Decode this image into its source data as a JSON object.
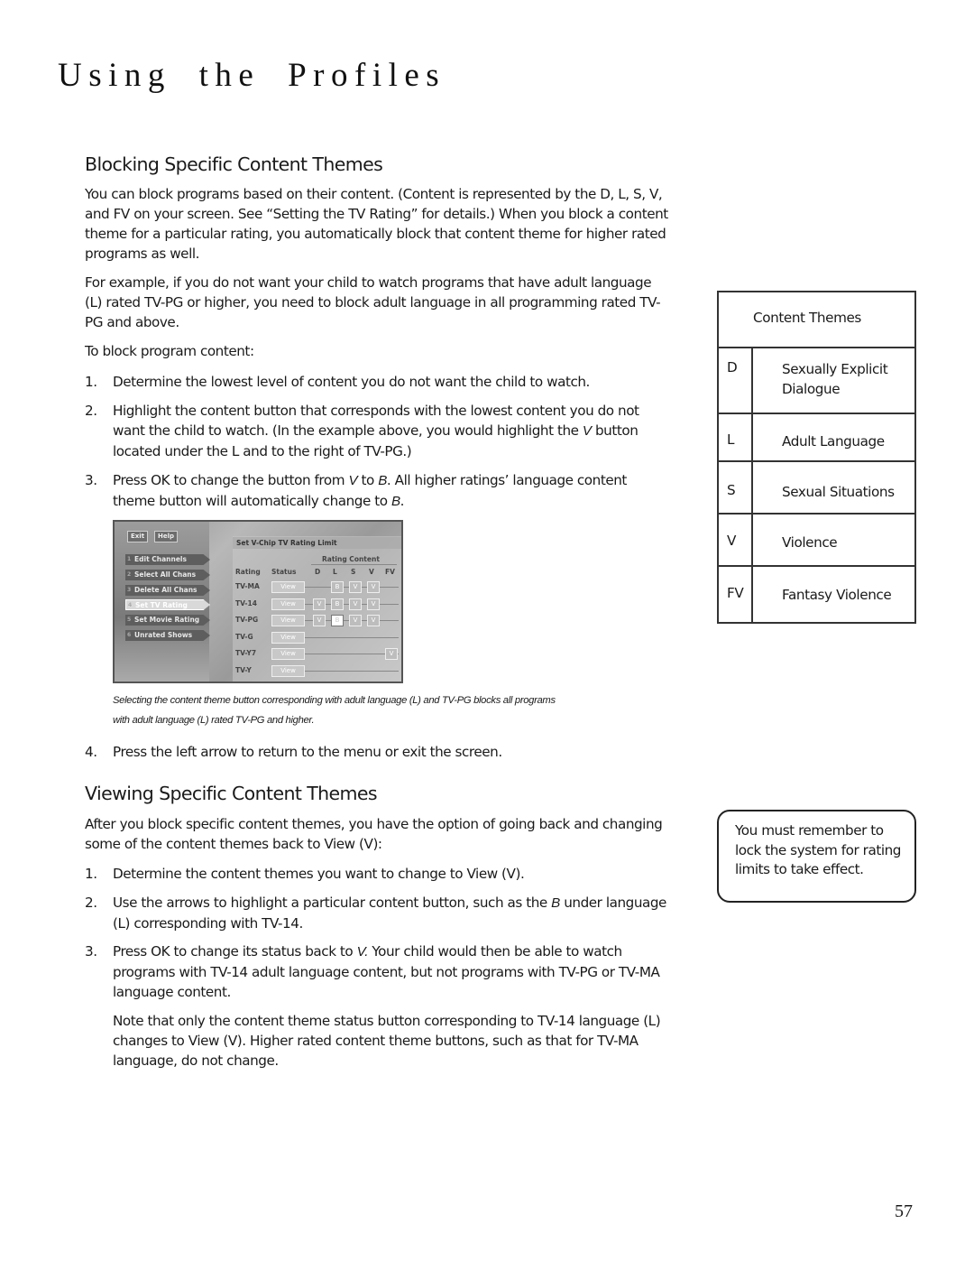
{
  "page_title": "Using the Profiles",
  "section1": {
    "heading": "Blocking Specific Content Themes",
    "para1": "You can block programs based on their content. (Content is represented by the D, L, S, V, and FV on your screen. See “Setting the TV Rating” for details.) When you block a content theme for a particular rating, you automatically block that content theme for higher rated programs as well.",
    "para2": "For example, if you do not want your child to watch programs that have adult language (L) rated TV-PG or higher, you need to block adult language in all programming rated TV-PG and above.",
    "intro": "To block program content:",
    "steps": [
      {
        "num": "1.",
        "text": "Determine the lowest level of content you do not want the child to watch."
      },
      {
        "num": "2.",
        "text_a": "Highlight the content button that corresponds with the lowest content you do not want the child to watch.  (In the example above, you would highlight the ",
        "em": "V",
        "text_b": " button located under the L and to the right of TV-PG.)"
      },
      {
        "num": "3.",
        "text_a": "Press OK to change the button from ",
        "em1": "V",
        "text_b": " to ",
        "em2": "B",
        "text_c": ". All higher ratings’ language content theme button will automatically change to ",
        "em3": "B",
        "text_d": "."
      },
      {
        "num": "4.",
        "text": "Press the left arrow to return to the menu or exit the screen."
      }
    ],
    "caption": "Selecting the content theme button corresponding with adult language (L) and TV-PG blocks all programs with adult language (L) rated TV-PG and higher."
  },
  "screenshot": {
    "top_buttons": [
      "Exit",
      "Help"
    ],
    "menu": [
      "Edit Channels",
      "Select All Chans",
      "Delete All Chans",
      "Set TV Rating",
      "Set Movie Rating",
      "Unrated Shows"
    ],
    "menu_numbers": [
      "1",
      "2",
      "3",
      "4",
      "5",
      "6"
    ],
    "panel_title": "Set V-Chip TV Rating Limit",
    "rating_content_label": "Rating Content",
    "col_rating": "Rating",
    "col_status": "Status",
    "content_cols": [
      "D",
      "L",
      "S",
      "V",
      "FV"
    ],
    "rows": [
      {
        "rating": "TV-MA",
        "status": "View",
        "cells": [
          "",
          "B",
          "V",
          "V",
          ""
        ]
      },
      {
        "rating": "TV-14",
        "status": "View",
        "cells": [
          "V",
          "B",
          "V",
          "V",
          ""
        ]
      },
      {
        "rating": "TV-PG",
        "status": "View",
        "cells": [
          "V",
          "B",
          "V",
          "V",
          ""
        ]
      },
      {
        "rating": "TV-G",
        "status": "View",
        "cells": [
          "",
          "",
          "",
          "",
          ""
        ]
      },
      {
        "rating": "TV-Y7",
        "status": "View",
        "cells": [
          "",
          "",
          "",
          "",
          "V"
        ]
      },
      {
        "rating": "TV-Y",
        "status": "View",
        "cells": [
          "",
          "",
          "",
          "",
          ""
        ]
      }
    ]
  },
  "section2": {
    "heading": "Viewing Specific Content Themes",
    "para1": "After you block specific content themes, you have the option of going back and changing some of the content themes back to View (V):",
    "steps": [
      {
        "num": "1.",
        "text": "Determine the content themes you want to change to View (V)."
      },
      {
        "num": "2.",
        "text_a": "Use the arrows to highlight a particular content button, such as the ",
        "em": "B",
        "text_b": " under language (L) corresponding with TV-14."
      },
      {
        "num": "3.",
        "text_a": "Press OK to change its status back to ",
        "em": "V.",
        "text_b": "  Your child would then be able to watch programs with TV-14 adult language content, but not programs with TV-PG or TV-MA language content."
      }
    ],
    "note": "Note that only the content theme status button corresponding to TV-14 language (L) changes to View (V). Higher rated content theme buttons, such as that for TV-MA language, do not change."
  },
  "content_themes_table": {
    "header": "Content Themes",
    "rows": [
      {
        "code": "D",
        "desc": "Sexually Explicit Dialogue"
      },
      {
        "code": "L",
        "desc": "Adult Language"
      },
      {
        "code": "S",
        "desc": "Sexual Situations"
      },
      {
        "code": "V",
        "desc": "Violence"
      },
      {
        "code": "FV",
        "desc": "Fantasy Violence"
      }
    ]
  },
  "sidebar_note": "You must remember to lock the system for rating limits to take effect.",
  "page_number": "57"
}
